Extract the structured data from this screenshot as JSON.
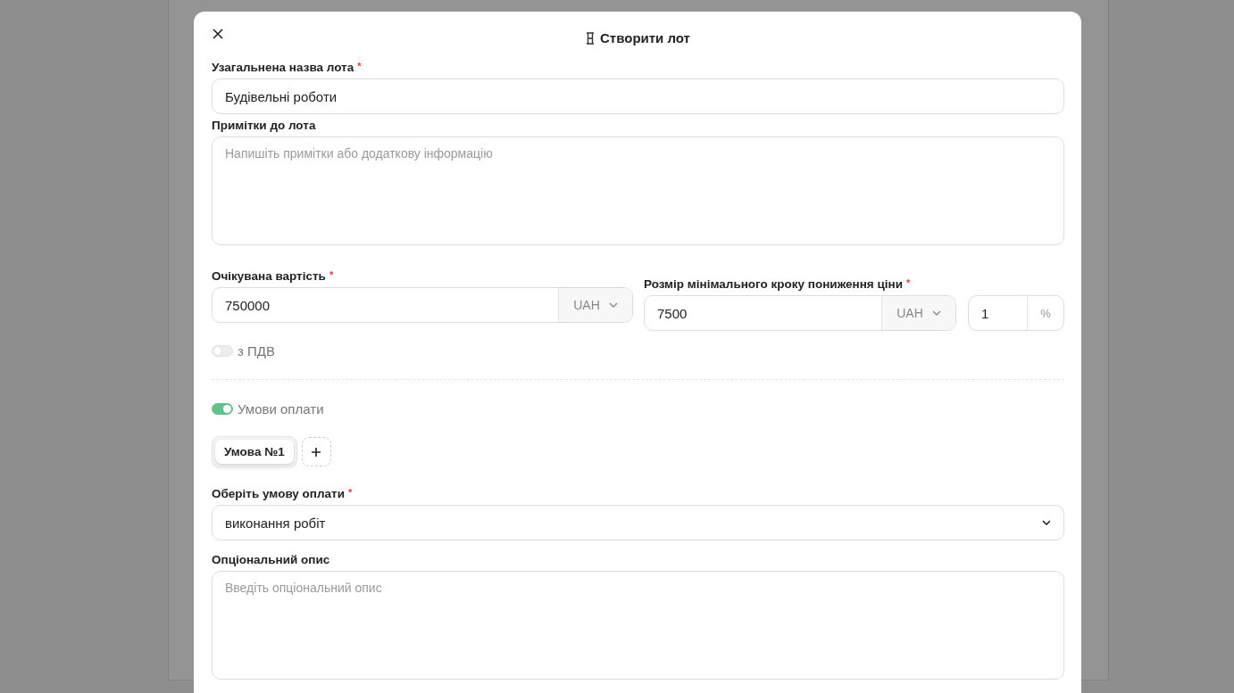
{
  "dialog": {
    "title": "Створити лот",
    "lot_name": {
      "label": "Узагальнена назва лота",
      "required_mark": "*",
      "value": "Будівельні роботи"
    },
    "notes": {
      "label": "Примітки до лота",
      "placeholder": "Напишіть примітки або додаткову інформацію"
    },
    "expected_cost": {
      "label": "Очікувана вартість",
      "required_mark": "*",
      "value": "750000",
      "currency": "UAH"
    },
    "min_step": {
      "label": "Розмір мінімального кроку пониження ціни",
      "required_mark": "*",
      "value": "7500",
      "currency": "UAH",
      "percent": "1",
      "percent_unit": "%"
    },
    "vat_toggle": {
      "label": "з ПДВ",
      "on": false
    },
    "payment_toggle": {
      "label": "Умови оплати",
      "on": true
    },
    "conditions": [
      {
        "label": "Умова №1",
        "selected": true
      }
    ],
    "payment_condition": {
      "label": "Оберіть умову оплати",
      "required_mark": "*",
      "value": "виконання робіт"
    },
    "optional_description": {
      "label": "Опціональний опис",
      "placeholder": "Введіть опціональний опис"
    }
  }
}
